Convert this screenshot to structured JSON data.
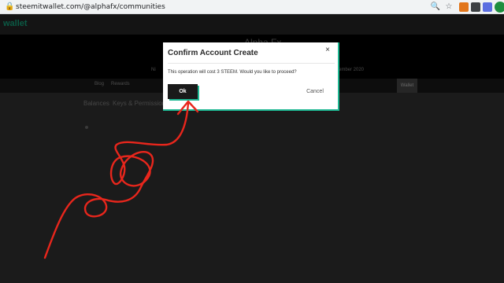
{
  "browser": {
    "url": "steemitwallet.com/@alphafx/communities",
    "icons": [
      "lock-icon",
      "zoom-icon",
      "bookmark-star-icon",
      "extension-fox-icon",
      "extension-grid-icon",
      "extension-t-icon",
      "extension-puzzle-icon",
      "profile-avatar-icon"
    ]
  },
  "site": {
    "brand": "wallet",
    "profile_name": "Alpha Fx",
    "profile_location_prefix": "Ni",
    "profile_joined": "ember 2020",
    "nav": [
      "Blog",
      "Rewards"
    ],
    "active_tab": "Wallet",
    "subnav": [
      "Balances",
      "Keys & Permissions"
    ]
  },
  "modal": {
    "title": "Confirm Account Create",
    "close_glyph": "×",
    "message": "This operation will cost 3 STEEM. Would you like to proceed?",
    "ok_label": "Ok",
    "cancel_label": "Cancel"
  },
  "colors": {
    "accent": "#1fb893",
    "annotation": "#e8261c",
    "modal_button": "#1a1a1a"
  }
}
